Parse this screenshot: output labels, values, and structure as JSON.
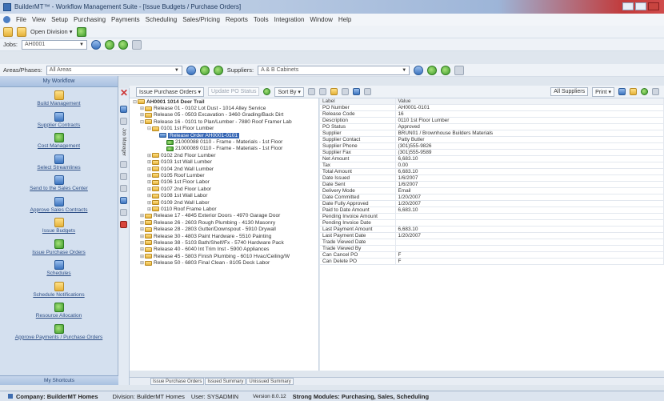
{
  "window": {
    "title": "BuilderMT™ - Workflow Management Suite - [Issue Budgets / Purchase Orders]"
  },
  "menu": [
    "File",
    "View",
    "Setup",
    "Purchasing",
    "Payments",
    "Scheduling",
    "Sales/Pricing",
    "Reports",
    "Tools",
    "Integration",
    "Window",
    "Help"
  ],
  "toolbar1": {
    "open_division": "Open Division ▾"
  },
  "toolbar2": {
    "jobs_label": "Jobs:",
    "jobs_value": "AH0001"
  },
  "toolbar3": {
    "areas_label": "Areas/Phases:",
    "areas_value": "All Areas",
    "suppliers_label": "Suppliers:",
    "suppliers_value": "A & B Cabinets"
  },
  "nav": {
    "header": "My Workflow",
    "footer": "My Shortcuts",
    "items": [
      "Build Management",
      "Supplier Contracts",
      "Cost Management",
      "Select Streamlines",
      "Send to the Sales Center",
      "Approve Sales Contracts",
      "Issue Budgets",
      "Issue Purchase Orders",
      "Schedules",
      "Schedule Notifications",
      "Resource Allocation",
      "Approve Payments / Purchase Orders"
    ]
  },
  "strip": {
    "label": "Job Manager"
  },
  "actions": {
    "issue_po": "Issue Purchase Orders ▾",
    "update_po": "Update PO Status",
    "sort_by": "Sort By ▾",
    "all_suppliers": "All Suppliers",
    "print": "Print ▾"
  },
  "tree": [
    {
      "text": "AH0001 1014 Deer Trail",
      "level": 0,
      "cls": "root",
      "exp": "−"
    },
    {
      "text": "Release 01 - 0102 Lot Dust - 1014 Alley Service",
      "level": 1,
      "exp": "+"
    },
    {
      "text": "Release 05 - 0503 Excavation - 3460 Grading/Back Dirt",
      "level": 1,
      "exp": "+"
    },
    {
      "text": "Release 16 - 0101 to Plan/Lumber - 7880 Roof Framer Lab",
      "level": 1,
      "exp": "−"
    },
    {
      "text": "0101 1st Floor Lumber",
      "level": 2,
      "exp": "−"
    },
    {
      "text": "Release Order AH0001-0101",
      "level": 3,
      "exp": "",
      "cls": "sel"
    },
    {
      "text": "21000088 0110 - Frame - Materials - 1st Floor",
      "level": 4,
      "exp": ""
    },
    {
      "text": "21000089 0110 - Frame - Materials - 1st Floor",
      "level": 4,
      "exp": ""
    },
    {
      "text": "0102 2nd Floor Lumber",
      "level": 2,
      "exp": "+"
    },
    {
      "text": "0103 1st Wall Lumber",
      "level": 2,
      "exp": "+"
    },
    {
      "text": "0104 2nd Wall Lumber",
      "level": 2,
      "exp": "+"
    },
    {
      "text": "0105 Roof Lumber",
      "level": 2,
      "exp": "+"
    },
    {
      "text": "0106 1st Floor Labor",
      "level": 2,
      "exp": "+"
    },
    {
      "text": "0107 2nd Floor Labor",
      "level": 2,
      "exp": "+"
    },
    {
      "text": "0108 1st Wall Labor",
      "level": 2,
      "exp": "+"
    },
    {
      "text": "0109 2nd Wall Labor",
      "level": 2,
      "exp": "+"
    },
    {
      "text": "0110 Roof Frame Labor",
      "level": 2,
      "exp": "+"
    },
    {
      "text": "Release 17 - 4845 Exterior Doors - 4970 Garage Door",
      "level": 1,
      "exp": "+"
    },
    {
      "text": "Release 26 - 2603 Rough Plumbing - 4130 Masonry",
      "level": 1,
      "exp": "+"
    },
    {
      "text": "Release 28 - 2803 Gutter/Downspout - 5910 Drywall",
      "level": 1,
      "exp": "+"
    },
    {
      "text": "Release 30 - 4803 Paint Hardware - 5510 Painting",
      "level": 1,
      "exp": "+"
    },
    {
      "text": "Release 38 - 5103 Bath/Shelf/Fx - 5740 Hardware Pack",
      "level": 1,
      "exp": "+"
    },
    {
      "text": "Release 40 - 6040 Int Trim Inst - 5900 Appliances",
      "level": 1,
      "exp": "+"
    },
    {
      "text": "Release 45 - 5803 Finish Plumbing - 6010 Hvac/Ceiling/W",
      "level": 1,
      "exp": "+"
    },
    {
      "text": "Release 50 - 6803 Final Clean - 8105 Deck Labor",
      "level": 1,
      "exp": "+"
    }
  ],
  "grid": {
    "headers": [
      "Label",
      "Value"
    ],
    "rows": [
      [
        "PO Number",
        "AH0001-0101"
      ],
      [
        "Release Code",
        "16"
      ],
      [
        "Description",
        "0110 1st Floor Lumber"
      ],
      [
        "PO Status",
        "Approved"
      ],
      [
        "Supplier",
        "BRUN01 / Brownhouse Builders Materials"
      ],
      [
        "Supplier Contact",
        "Patty Butler"
      ],
      [
        "Supplier Phone",
        "(301)555-9826"
      ],
      [
        "Supplier Fax",
        "(301)555-9589"
      ],
      [
        "Net Amount",
        "6,683.10"
      ],
      [
        "Tax",
        "0.00"
      ],
      [
        "Total Amount",
        "6,683.10"
      ],
      [
        "Date Issued",
        "1/6/2007"
      ],
      [
        "Date Sent",
        "1/6/2007"
      ],
      [
        "Delivery Mode",
        "Email"
      ],
      [
        "Date Committed",
        "1/20/2007"
      ],
      [
        "Date Fully Approved",
        "1/20/2007"
      ],
      [
        "Paid to Date Amount",
        "6,683.10"
      ],
      [
        "Pending Invoice Amount",
        ""
      ],
      [
        "Pending Invoice Date",
        ""
      ],
      [
        "Last Payment Amount",
        "6,683.10"
      ],
      [
        "Last Payment Date",
        "1/20/2007"
      ],
      [
        "Trade Viewed Date",
        ""
      ],
      [
        "Trade Viewed By",
        ""
      ],
      [
        "Can Cancel PO",
        "F"
      ],
      [
        "Can Delete PO",
        "F"
      ]
    ]
  },
  "tabs": [
    "Issue Purchase Orders",
    "Issued Summary",
    "Unissued Summary"
  ],
  "status": {
    "company": "Company: BuilderMT Homes",
    "division": "Division: BuilderMT Homes",
    "user": "User: SYSADMIN",
    "version": "Version 8.0.12",
    "strong": "Strong Modules: Purchasing, Sales, Scheduling"
  }
}
